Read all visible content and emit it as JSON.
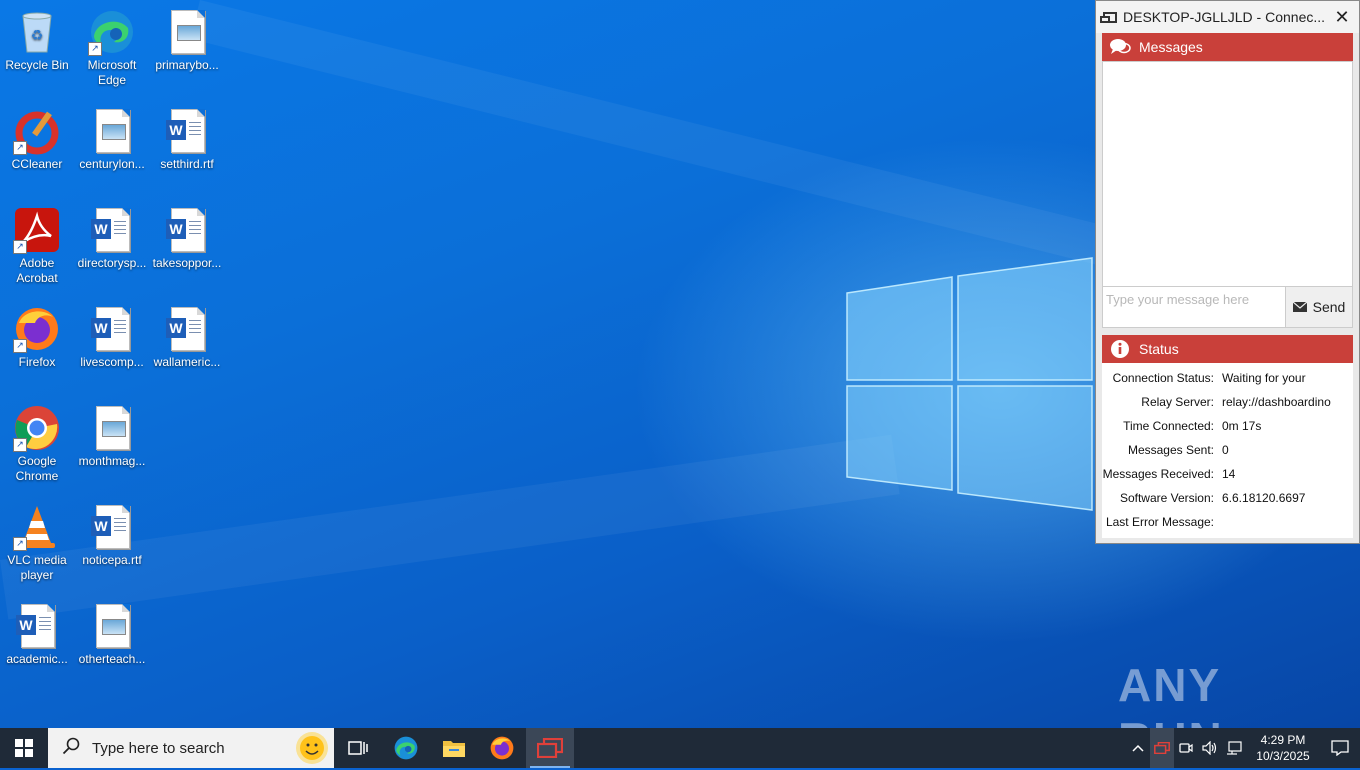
{
  "desktop": {
    "icons": [
      {
        "label": "Recycle Bin",
        "icon": "recycle-bin-icon"
      },
      {
        "label": "Microsoft Edge",
        "icon": "edge-icon"
      },
      {
        "label": "primarybo...",
        "icon": "image-file-icon"
      },
      {
        "label": "CCleaner",
        "icon": "ccleaner-icon"
      },
      {
        "label": "centurylon...",
        "icon": "image-file-icon"
      },
      {
        "label": "setthird.rtf",
        "icon": "word-file-icon"
      },
      {
        "label": "Adobe Acrobat",
        "icon": "acrobat-icon"
      },
      {
        "label": "directorysp...",
        "icon": "word-file-icon"
      },
      {
        "label": "takesoppor...",
        "icon": "word-file-icon"
      },
      {
        "label": "Firefox",
        "icon": "firefox-icon"
      },
      {
        "label": "livescomp...",
        "icon": "word-file-icon"
      },
      {
        "label": "wallameric...",
        "icon": "word-file-icon"
      },
      {
        "label": "Google Chrome",
        "icon": "chrome-icon"
      },
      {
        "label": "monthmag...",
        "icon": "image-file-icon"
      },
      {
        "label": "VLC media player",
        "icon": "vlc-icon"
      },
      {
        "label": "noticepa.rtf",
        "icon": "word-file-icon"
      },
      {
        "label": "academic...",
        "icon": "word-file-icon"
      },
      {
        "label": "otherteach...",
        "icon": "image-file-icon"
      }
    ],
    "watermark": "ANY RUN"
  },
  "app_window": {
    "title": "DESKTOP-JGLLJLD - Connec...",
    "close_label": "✕",
    "messages": {
      "header": "Messages",
      "input_placeholder": "Type your message here",
      "send_label": "Send"
    },
    "status": {
      "header": "Status",
      "rows": [
        {
          "key": "Connection Status:",
          "value": "Waiting for your"
        },
        {
          "key": "Relay Server:",
          "value": "relay://dashboardino"
        },
        {
          "key": "Time Connected:",
          "value": "0m 17s"
        },
        {
          "key": "Messages Sent:",
          "value": "0"
        },
        {
          "key": "Messages Received:",
          "value": "14"
        },
        {
          "key": "Software Version:",
          "value": "6.6.18120.6697"
        },
        {
          "key": "Last Error Message:",
          "value": ""
        }
      ]
    },
    "colors": {
      "header_red": "#c9403a"
    }
  },
  "taskbar": {
    "search_placeholder": "Type here to search",
    "apps": [
      "task-view-icon",
      "edge-icon",
      "file-explorer-icon",
      "firefox-icon",
      "remote-support-icon"
    ],
    "clock": {
      "time": "4:29 PM",
      "date": "10/3/2025"
    }
  }
}
